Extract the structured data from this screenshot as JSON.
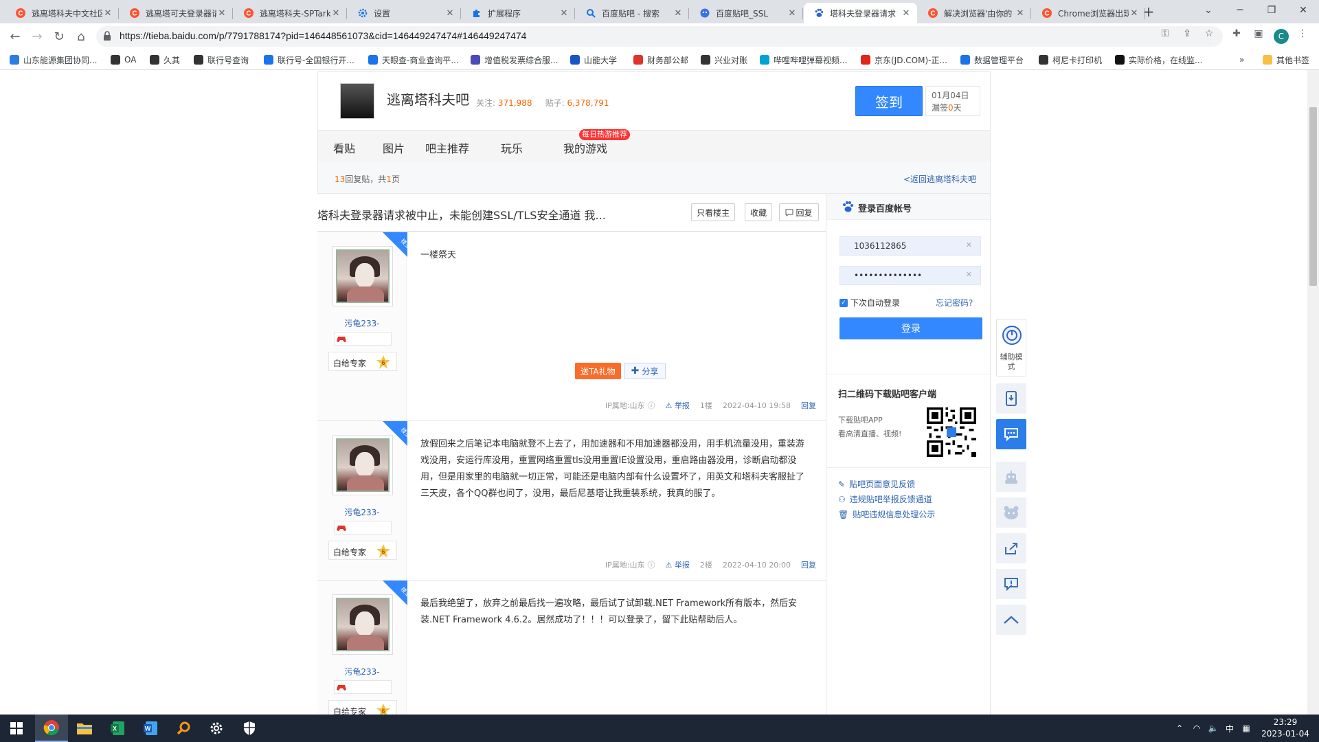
{
  "browser": {
    "tabs": [
      {
        "title": "逃离塔科夫中文社区",
        "icon": "csdn-icon",
        "active": false
      },
      {
        "title": "逃离塔可夫登录器请求",
        "icon": "csdn-icon",
        "active": false
      },
      {
        "title": "逃离塔科夫-SPTarkov",
        "icon": "csdn-icon",
        "active": false
      },
      {
        "title": "设置",
        "icon": "settings-icon",
        "active": false
      },
      {
        "title": "扩展程序",
        "icon": "extensions-icon",
        "active": false
      },
      {
        "title": "百度贴吧 - 搜索",
        "icon": "search-icon",
        "active": false
      },
      {
        "title": "百度贴吧_SSL",
        "icon": "tieba-icon",
        "active": false
      },
      {
        "title": "塔科夫登录器请求",
        "icon": "paw-icon",
        "active": true
      },
      {
        "title": "解决浏览器'由你的",
        "icon": "csdn-icon",
        "active": false
      },
      {
        "title": "Chrome浏览器出现",
        "icon": "csdn-icon",
        "active": false
      }
    ],
    "url": "https://tieba.baidu.com/p/7791788174?pid=146448561073&cid=146449247474#146449247474",
    "profile_initial": "C",
    "bookmarks": [
      {
        "label": "山东能源集团协同...",
        "color": "#2a7de1"
      },
      {
        "label": "OA",
        "color": "#333333"
      },
      {
        "label": "久其",
        "color": "#333333"
      },
      {
        "label": "联行号查询",
        "color": "#333333"
      },
      {
        "label": "联行号-全国银行开...",
        "color": "#1a73e8"
      },
      {
        "label": "天眼查-商业查询平...",
        "color": "#1a73e8"
      },
      {
        "label": "增值税发票综合服...",
        "color": "#4a4ab8"
      },
      {
        "label": "山能大学",
        "color": "#1a55c8"
      },
      {
        "label": "财务部公邮",
        "color": "#e0342a"
      },
      {
        "label": "兴业对账",
        "color": "#333333"
      },
      {
        "label": "哔哩哔哩弹幕视频...",
        "color": "#00a1d6"
      },
      {
        "label": "京东(JD.COM)-正...",
        "color": "#e1251b"
      },
      {
        "label": "数据管理平台",
        "color": "#1a73e8"
      },
      {
        "label": "柯尼卡打印机",
        "color": "#333333"
      },
      {
        "label": "实际价格，在线监...",
        "color": "#111111"
      }
    ],
    "other_bookmarks": "其他书签",
    "more_bookmarks": "»"
  },
  "forum": {
    "name": "逃离塔科夫吧",
    "follow_label": "关注:",
    "follow_count": "371,988",
    "posts_label": "贴子:",
    "posts_count": "6,378,791",
    "sign_button": "签到",
    "sign_date": "01月04日",
    "sign_missed_prefix": "漏签",
    "sign_missed_days": "0",
    "sign_missed_suffix": "天",
    "nav": [
      "看贴",
      "图片",
      "吧主推荐",
      "玩乐",
      "我的游戏"
    ],
    "hot_badge": "每日热游推荐",
    "reply_count": "13",
    "reply_text": "回复贴，共",
    "page_count": "1",
    "page_text": "页",
    "back_link": "<返回逃离塔科夫吧"
  },
  "thread": {
    "title": "塔科夫登录器请求被中止，未能创建SSL/TLS安全通道 我...",
    "buttons": {
      "only_op": "只看楼主",
      "favorite": "收藏",
      "reply": "回复"
    },
    "posts": [
      {
        "user": "污龟233-",
        "badge": "白给专家",
        "level": "6",
        "content": "一楼祭天",
        "gift": "送TA礼物",
        "share": "分享",
        "ip": "IP属地:山东",
        "report": "举报",
        "floor": "1楼",
        "time": "2022-04-10 19:58",
        "reply": "回复"
      },
      {
        "user": "污龟233-",
        "badge": "白给专家",
        "level": "6",
        "content": "放假回来之后笔记本电脑就登不上去了，用加速器和不用加速器都没用，用手机流量没用，重装游戏没用，安运行库没用，重置网络重置tls没用重置IE设置没用，重启路由器没用，诊断启动都没用，但是用家里的电脑就一切正常，可能还是电脑内部有什么设置坏了，用英文和塔科夫客服扯了三天皮，各个QQ群也问了，没用，最后尼基塔让我重装系统，我真的服了。",
        "ip": "IP属地:山东",
        "report": "举报",
        "floor": "2楼",
        "time": "2022-04-10 20:00",
        "reply": "回复"
      },
      {
        "user": "污龟233-",
        "badge": "白给专家",
        "level": "6",
        "content": "最后我绝望了，放弃之前最后找一遍攻略，最后试了试卸载.NET Framework所有版本，然后安装.NET Framework 4.6.2。居然成功了！！！可以登录了，留下此贴帮助后人。"
      }
    ]
  },
  "login": {
    "title": "登录百度帐号",
    "username": "1036112865",
    "password": "••••••••••••••",
    "remember": "下次自动登录",
    "forgot": "忘记密码?",
    "button": "登录",
    "qr_title": "扫二维码下载贴吧客户端",
    "qr_sub1": "下载贴吧APP",
    "qr_sub2": "看高清直播、视频!",
    "links": [
      "贴吧页面意见反馈",
      "违规贴吧举报反馈通道",
      "贴吧违规信息处理公示"
    ]
  },
  "float_sidebar": {
    "assist_label": "辅助模式"
  },
  "taskbar": {
    "time": "23:29",
    "date": "2023-01-04",
    "ime": "中"
  },
  "colors": {
    "accent": "#3388ff",
    "link": "#2d64b3",
    "orange": "#ff6600"
  }
}
